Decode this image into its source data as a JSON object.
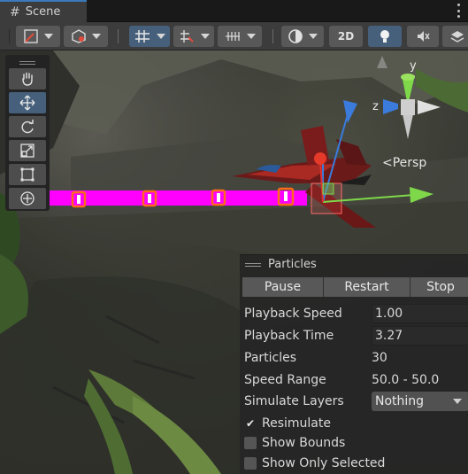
{
  "tab": {
    "title": "Scene",
    "icon": "hash-icon"
  },
  "toolbar": {
    "mode_2d_label": "2D",
    "buttons": [
      "draw-mode-icon",
      "render-mode-icon",
      "grid-snap-icon",
      "increment-snap-icon",
      "grid-icon",
      "shading-icon",
      "2d-toggle",
      "lighting-icon",
      "audio-mute-icon",
      "effects-icon"
    ]
  },
  "viewport": {
    "persp_label": "Persp",
    "gizmo_axes": {
      "y": "y",
      "z": "z"
    }
  },
  "tools": [
    "hand-icon",
    "move-icon",
    "rotate-icon",
    "scale-icon",
    "rect-icon",
    "transform-icon"
  ],
  "particles": {
    "title": "Particles",
    "buttons": {
      "pause": "Pause",
      "restart": "Restart",
      "stop": "Stop"
    },
    "rows": {
      "playback_speed": {
        "label": "Playback Speed",
        "value": "1.00"
      },
      "playback_time": {
        "label": "Playback Time",
        "value": "3.27"
      },
      "particles": {
        "label": "Particles",
        "value": "30"
      },
      "speed_range": {
        "label": "Speed Range",
        "value": "50.0 - 50.0"
      },
      "simulate_layers": {
        "label": "Simulate Layers",
        "value": "Nothing"
      }
    },
    "checkboxes": {
      "resimulate": {
        "label": "Resimulate",
        "checked": true
      },
      "show_bounds": {
        "label": "Show Bounds",
        "checked": false
      },
      "show_only_selected": {
        "label": "Show Only Selected",
        "checked": false
      }
    }
  },
  "colors": {
    "accent": "#3a79bb",
    "selected_tool": "#46607c",
    "magenta": "#ff00ff",
    "axis_x": "#e03030",
    "axis_y": "#7fd84a",
    "axis_z": "#3b7bdc"
  }
}
